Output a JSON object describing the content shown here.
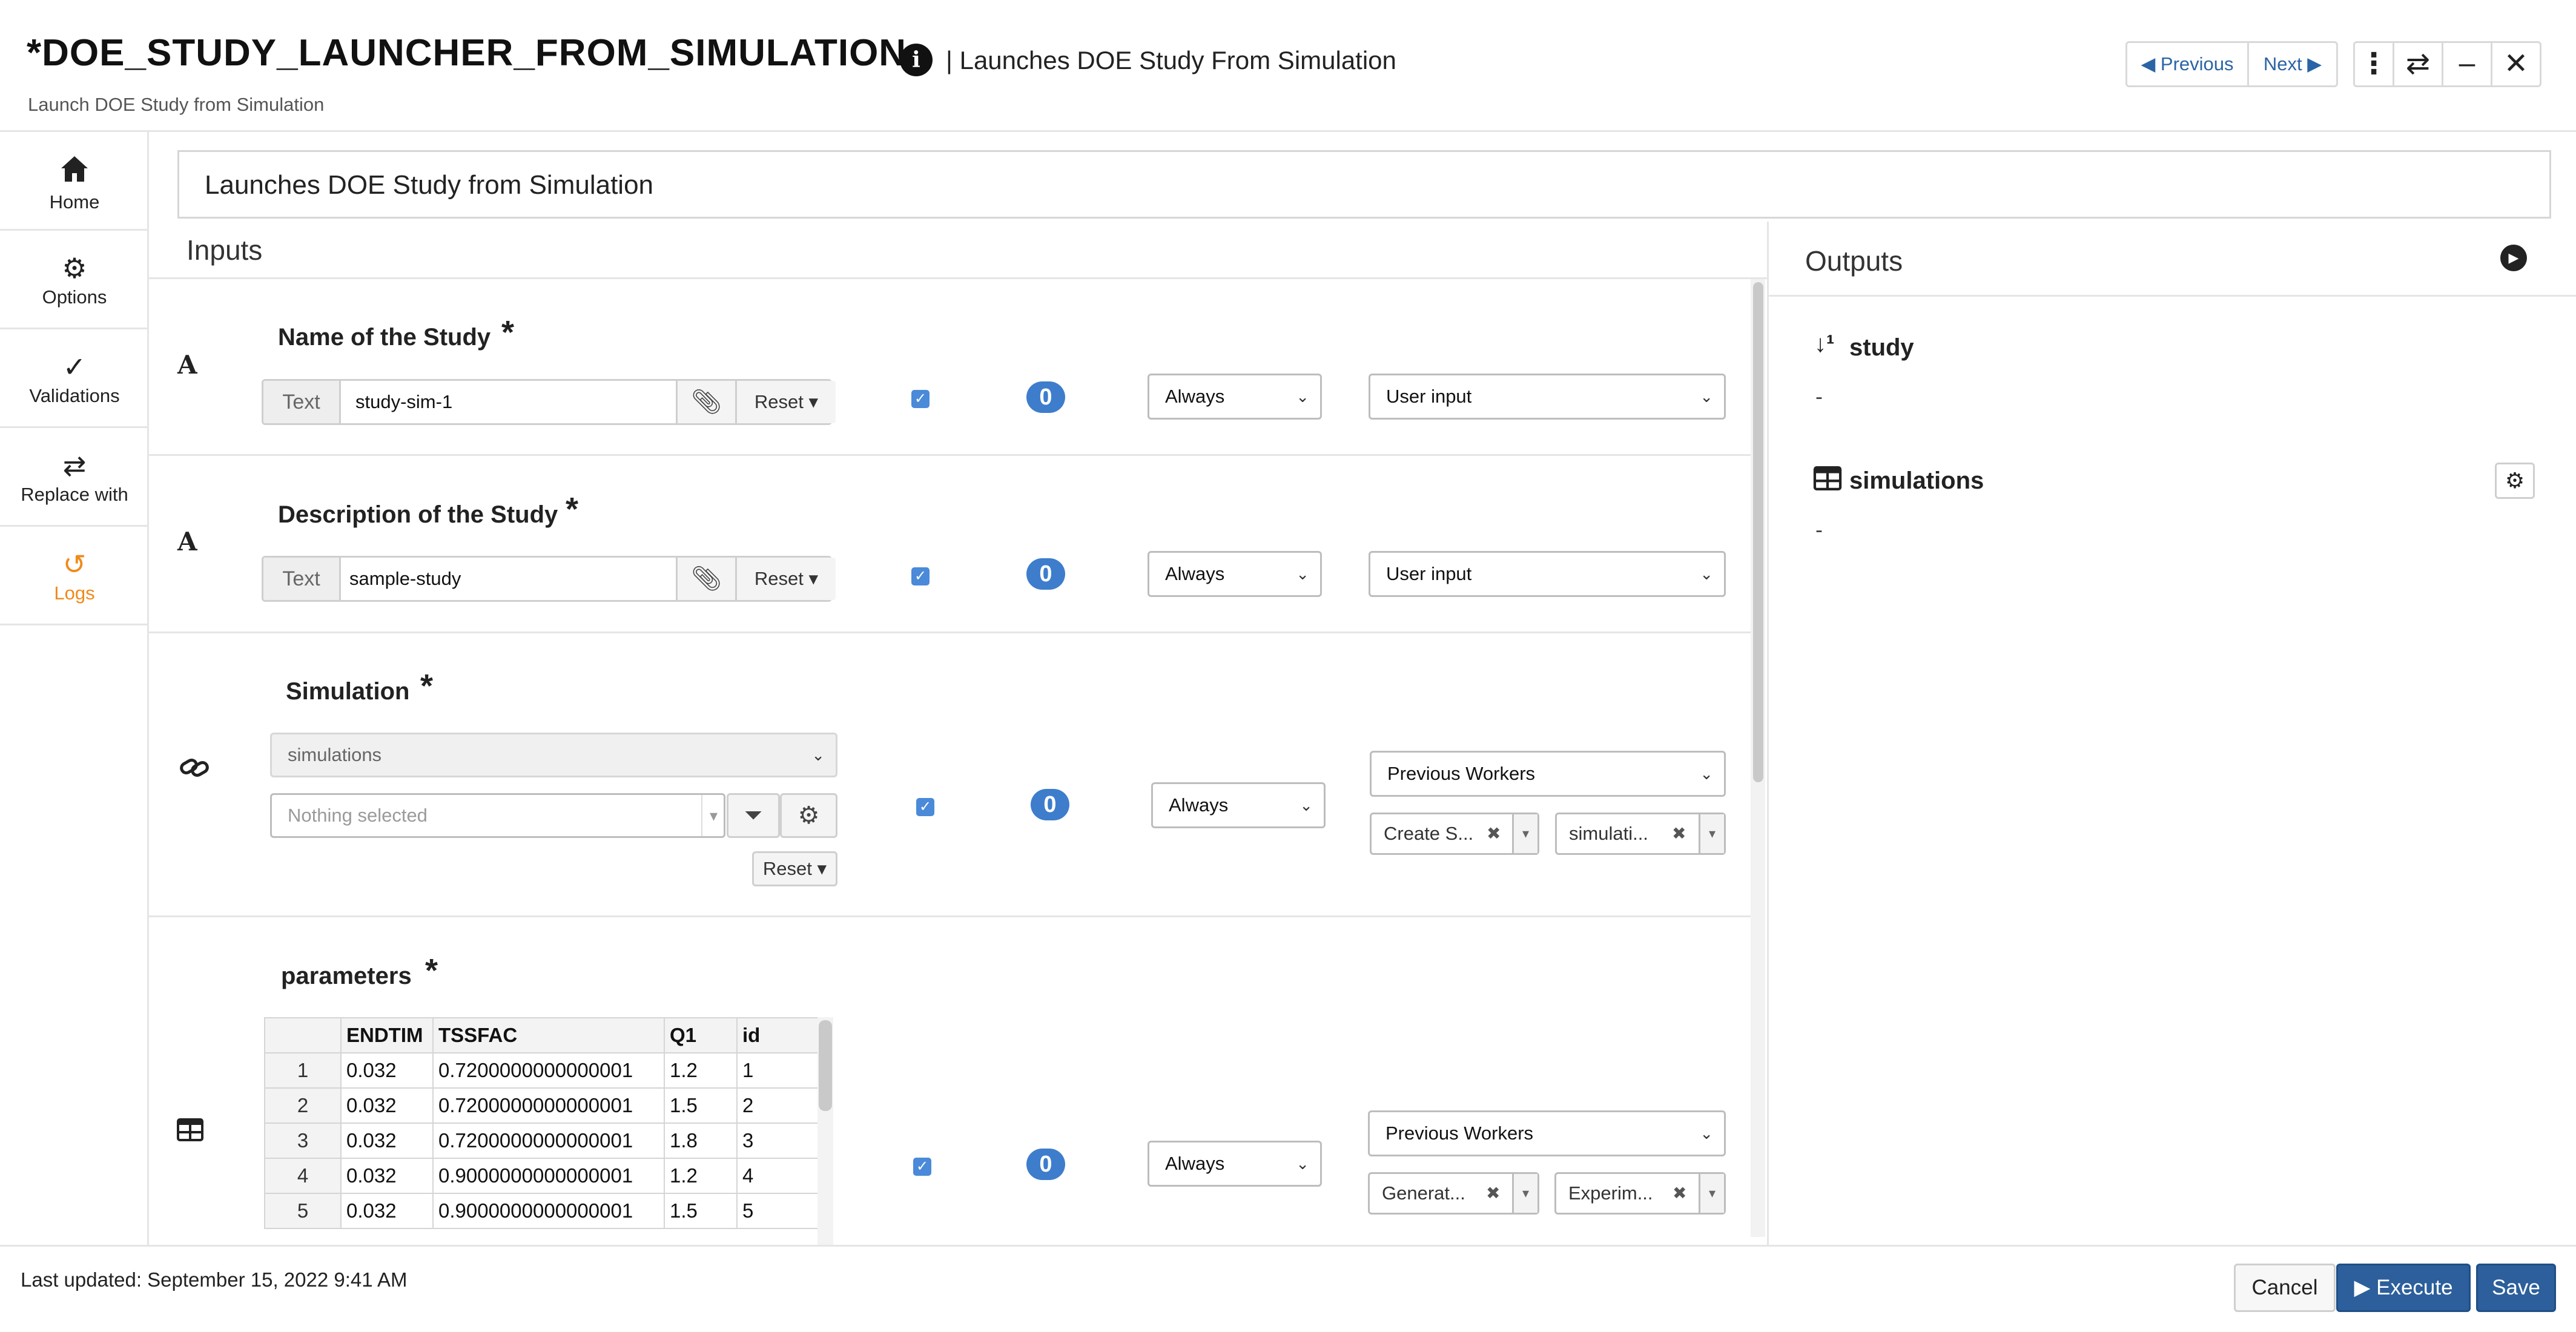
{
  "header": {
    "title": "*DOE_STUDY_LAUNCHER_FROM_SIMULATION",
    "title_suffix": "| Launches DOE Study From Simulation",
    "subtitle": "Launch DOE Study from Simulation",
    "prev_label": "Previous",
    "next_label": "Next",
    "icons": [
      "info-icon",
      "kebab-icon",
      "swap-icon",
      "minimize-icon",
      "close-icon"
    ]
  },
  "sidebar": {
    "items": [
      {
        "label": "Home",
        "icon": "home-icon"
      },
      {
        "label": "Options",
        "icon": "gear-icon"
      },
      {
        "label": "Validations",
        "icon": "check-icon"
      },
      {
        "label": "Replace with",
        "icon": "swap-icon"
      },
      {
        "label": "Logs",
        "icon": "history-icon",
        "active": true
      }
    ],
    "active_color": "#ef8a1a"
  },
  "main": {
    "task_title": "Launches DOE Study from Simulation",
    "inputs_title": "Inputs",
    "inputs": [
      {
        "label": "Name of the Study",
        "required": "*",
        "type_addon": "Text",
        "value": "study-sim-1",
        "reset_label": "Reset",
        "count": "0",
        "condition": "Always",
        "source": "User input"
      },
      {
        "label": "Description of the Study",
        "required": "*",
        "type_addon": "Text",
        "value": "sample-study",
        "reset_label": "Reset",
        "count": "0",
        "condition": "Always",
        "source": "User input"
      },
      {
        "label": "Simulation",
        "required": "*",
        "collection": "simulations",
        "selection_placeholder": "Nothing selected",
        "reset_label": "Reset",
        "count": "0",
        "condition": "Always",
        "source": "Previous Workers",
        "tags": [
          "Create S...",
          "simulati..."
        ]
      },
      {
        "label": "parameters",
        "required": "*",
        "count": "0",
        "condition": "Always",
        "source": "Previous Workers",
        "tags": [
          "Generat...",
          "Experim..."
        ],
        "table": {
          "columns": [
            "",
            "ENDTIM",
            "TSSFAC",
            "Q1",
            "id"
          ],
          "rows": [
            [
              "1",
              "0.032",
              "0.7200000000000001",
              "1.2",
              "1"
            ],
            [
              "2",
              "0.032",
              "0.7200000000000001",
              "1.5",
              "2"
            ],
            [
              "3",
              "0.032",
              "0.7200000000000001",
              "1.8",
              "3"
            ],
            [
              "4",
              "0.032",
              "0.9000000000000001",
              "1.2",
              "4"
            ],
            [
              "5",
              "0.032",
              "0.9000000000000001",
              "1.5",
              "5"
            ]
          ]
        }
      }
    ]
  },
  "outputs": {
    "title": "Outputs",
    "items": [
      {
        "label": "study",
        "icon": "sort-numeric-icon",
        "value": "-"
      },
      {
        "label": "simulations",
        "icon": "table-icon",
        "value": "-"
      }
    ]
  },
  "footer": {
    "last_updated": "Last updated: September 15, 2022 9:41 AM",
    "cancel_label": "Cancel",
    "execute_label": "Execute",
    "save_label": "Save"
  },
  "colors": {
    "primary": "#2c5f9b",
    "badge": "#3d7dcc",
    "link": "#2a64a6",
    "accent": "#ef8a1a"
  }
}
